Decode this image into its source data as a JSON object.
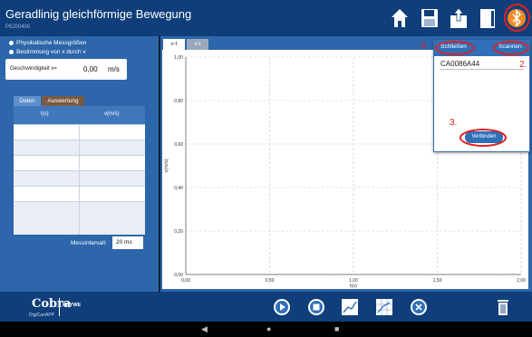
{
  "header": {
    "title": "Geradlinig gleichförmige Bewegung",
    "subtitle": "P6200400",
    "icons": [
      "home-icon",
      "save-icon",
      "export-icon",
      "document-icon",
      "bluetooth-icon"
    ]
  },
  "left_panel": {
    "options": [
      "Physikalische Messgrößen",
      "Bestimmung von x durch v"
    ],
    "speed": {
      "label": "Geschwindigkeit v=",
      "value": "0,00",
      "unit": "m/s"
    },
    "tabs": [
      "Daten",
      "Auswertung"
    ],
    "table": {
      "columns": [
        "t(s)",
        "v(m/s)"
      ],
      "rows": [
        [
          "",
          ""
        ],
        [
          "",
          ""
        ],
        [
          "",
          ""
        ],
        [
          "",
          ""
        ],
        [
          "",
          ""
        ],
        [
          "",
          ""
        ]
      ]
    },
    "interval": {
      "label": "Messintervall:",
      "value": "20 ms"
    }
  },
  "chart_tabs": [
    "v-t",
    "x-t"
  ],
  "chart_data": {
    "type": "line",
    "title": "",
    "xlabel": "t(s)",
    "ylabel": "v(m/s)",
    "xlim": [
      0,
      2
    ],
    "ylim": [
      0,
      1
    ],
    "x_ticks": [
      "0,00",
      "0,50",
      "1,00",
      "1,50",
      "2,00"
    ],
    "y_ticks": [
      "0,00",
      "0,20",
      "0,40",
      "0,60",
      "0,80",
      "1,00"
    ],
    "grid": true,
    "series": []
  },
  "popup": {
    "close_label": "Schließen",
    "scan_label": "Scannen",
    "device": "CA0086A44",
    "connect_label": "Verbinden"
  },
  "annotations": [
    "4.",
    "2.",
    "3."
  ],
  "footer": {
    "logo": "Cobra",
    "logo_sub": "DigiCartAPP",
    "brand": "PHYWE",
    "buttons": [
      "play-icon",
      "stop-icon",
      "chart-icon",
      "table-chart-icon",
      "cancel-icon",
      "trash-icon"
    ]
  },
  "navbar": {
    "back": "◀",
    "home": "●",
    "recent": "■"
  },
  "colors": {
    "header": "#0f3e7a",
    "panel": "#2d66aa",
    "accent": "#2f6fb8",
    "highlight": "#e02020"
  }
}
